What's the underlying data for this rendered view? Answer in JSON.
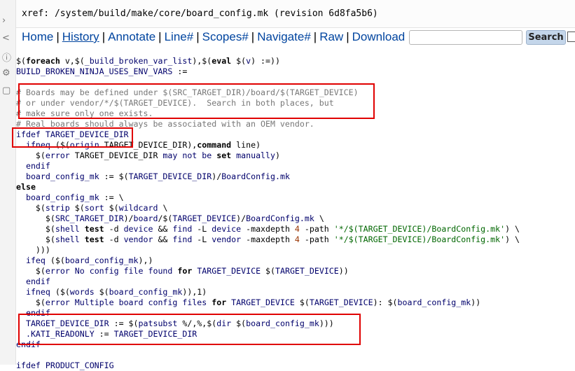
{
  "xref": {
    "text": "xref: /system/build/make/core/board_config.mk (revision 6d8fa5b6)"
  },
  "menu": [
    {
      "label": "Home"
    },
    {
      "label": "History"
    },
    {
      "label": "Annotate"
    },
    {
      "label": "Line#"
    },
    {
      "label": "Scopes#"
    },
    {
      "label": "Navigate#"
    },
    {
      "label": "Raw"
    },
    {
      "label": "Download"
    }
  ],
  "search": {
    "button": "Search",
    "value": ""
  },
  "left_icons": [
    "arrow-icon",
    "share-icon",
    "info-icon",
    "settings-icon",
    "file-icon"
  ],
  "code_lines": [
    [
      [
        "f",
        "$("
      ],
      [
        "k",
        "foreach"
      ],
      [
        "f",
        " v,$("
      ],
      [
        "v",
        "_build_broken_var_list"
      ],
      [
        "f",
        "),$("
      ],
      [
        "k",
        "eval"
      ],
      [
        "f",
        " $("
      ],
      [
        "v",
        "v"
      ],
      [
        "f",
        ") :=))"
      ]
    ],
    [
      [
        "v",
        "BUILD_BROKEN_NINJA_USES_ENV_VARS"
      ],
      [
        "f",
        " :="
      ]
    ],
    [
      [
        "f",
        ""
      ]
    ],
    [
      [
        "c",
        "# Boards may be defined under $(SRC_TARGET_DIR)/board/$(TARGET_DEVICE)"
      ]
    ],
    [
      [
        "c",
        "# or under vendor/*/$(TARGET_DEVICE).  Search in both places, but"
      ]
    ],
    [
      [
        "c",
        "# make sure only one exists."
      ]
    ],
    [
      [
        "c",
        "# Real boards should always be associated with an OEM vendor."
      ]
    ],
    [
      [
        "v",
        "ifdef TARGET_DEVICE_DIR"
      ]
    ],
    [
      [
        "f",
        "  "
      ],
      [
        "v",
        "ifneq"
      ],
      [
        "f",
        " ($("
      ],
      [
        "v",
        "origin"
      ],
      [
        "f",
        " TARGET_DEVICE_DIR),"
      ],
      [
        "k",
        "command"
      ],
      [
        "f",
        " line)"
      ]
    ],
    [
      [
        "f",
        "    $("
      ],
      [
        "v",
        "error"
      ],
      [
        "f",
        " TARGET_DEVICE_DIR "
      ],
      [
        "v",
        "may not be"
      ],
      [
        "f",
        " "
      ],
      [
        "k",
        "set"
      ],
      [
        "f",
        " "
      ],
      [
        "v",
        "manually"
      ],
      [
        "f",
        ")"
      ]
    ],
    [
      [
        "f",
        "  "
      ],
      [
        "v",
        "endif"
      ]
    ],
    [
      [
        "f",
        "  "
      ],
      [
        "v",
        "board_config_mk"
      ],
      [
        "f",
        " := $("
      ],
      [
        "v",
        "TARGET_DEVICE_DIR"
      ],
      [
        "f",
        ")/"
      ],
      [
        "v",
        "BoardConfig.mk"
      ]
    ],
    [
      [
        "k",
        "else"
      ]
    ],
    [
      [
        "f",
        "  "
      ],
      [
        "v",
        "board_config_mk"
      ],
      [
        "f",
        " := \\"
      ]
    ],
    [
      [
        "f",
        "    $("
      ],
      [
        "v",
        "strip"
      ],
      [
        "f",
        " $("
      ],
      [
        "v",
        "sort"
      ],
      [
        "f",
        " $("
      ],
      [
        "v",
        "wildcard"
      ],
      [
        "f",
        " \\"
      ]
    ],
    [
      [
        "f",
        "      $("
      ],
      [
        "v",
        "SRC_TARGET_DIR"
      ],
      [
        "f",
        ")/"
      ],
      [
        "v",
        "board"
      ],
      [
        "f",
        "/$("
      ],
      [
        "v",
        "TARGET_DEVICE"
      ],
      [
        "f",
        ")/"
      ],
      [
        "v",
        "BoardConfig.mk"
      ],
      [
        "f",
        " \\"
      ]
    ],
    [
      [
        "f",
        "      $("
      ],
      [
        "v",
        "shell"
      ],
      [
        "f",
        " "
      ],
      [
        "k",
        "test"
      ],
      [
        "f",
        " -d "
      ],
      [
        "v",
        "device"
      ],
      [
        "f",
        " && "
      ],
      [
        "v",
        "find"
      ],
      [
        "f",
        " -L "
      ],
      [
        "v",
        "device"
      ],
      [
        "f",
        " -maxdepth "
      ],
      [
        "n",
        "4"
      ],
      [
        "f",
        " -path "
      ],
      [
        "s",
        "'*/$(TARGET_DEVICE)/BoardConfig.mk'"
      ],
      [
        "f",
        ") \\"
      ]
    ],
    [
      [
        "f",
        "      $("
      ],
      [
        "v",
        "shell"
      ],
      [
        "f",
        " "
      ],
      [
        "k",
        "test"
      ],
      [
        "f",
        " -d "
      ],
      [
        "v",
        "vendor"
      ],
      [
        "f",
        " && "
      ],
      [
        "v",
        "find"
      ],
      [
        "f",
        " -L "
      ],
      [
        "v",
        "vendor"
      ],
      [
        "f",
        " -maxdepth "
      ],
      [
        "n",
        "4"
      ],
      [
        "f",
        " -path "
      ],
      [
        "s",
        "'*/$(TARGET_DEVICE)/BoardConfig.mk'"
      ],
      [
        "f",
        ") \\"
      ]
    ],
    [
      [
        "f",
        "    )))"
      ]
    ],
    [
      [
        "f",
        "  "
      ],
      [
        "v",
        "ifeq"
      ],
      [
        "f",
        " ($("
      ],
      [
        "v",
        "board_config_mk"
      ],
      [
        "f",
        "),)"
      ]
    ],
    [
      [
        "f",
        "    $("
      ],
      [
        "v",
        "error"
      ],
      [
        "f",
        " "
      ],
      [
        "v",
        "No config file found"
      ],
      [
        "f",
        " "
      ],
      [
        "k",
        "for"
      ],
      [
        "f",
        " "
      ],
      [
        "v",
        "TARGET_DEVICE"
      ],
      [
        "f",
        " $("
      ],
      [
        "v",
        "TARGET_DEVICE"
      ],
      [
        "f",
        "))"
      ]
    ],
    [
      [
        "f",
        "  "
      ],
      [
        "v",
        "endif"
      ]
    ],
    [
      [
        "f",
        "  "
      ],
      [
        "v",
        "ifneq"
      ],
      [
        "f",
        " ($("
      ],
      [
        "v",
        "words"
      ],
      [
        "f",
        " $("
      ],
      [
        "v",
        "board_config_mk"
      ],
      [
        "f",
        ")),1)"
      ]
    ],
    [
      [
        "f",
        "    $("
      ],
      [
        "v",
        "error"
      ],
      [
        "f",
        " "
      ],
      [
        "v",
        "Multiple board config files"
      ],
      [
        "f",
        " "
      ],
      [
        "k",
        "for"
      ],
      [
        "f",
        " "
      ],
      [
        "v",
        "TARGET_DEVICE"
      ],
      [
        "f",
        " $("
      ],
      [
        "v",
        "TARGET_DEVICE"
      ],
      [
        "f",
        "): $("
      ],
      [
        "v",
        "board_config_mk"
      ],
      [
        "f",
        "))"
      ]
    ],
    [
      [
        "f",
        "  "
      ],
      [
        "v",
        "endif"
      ]
    ],
    [
      [
        "f",
        "  "
      ],
      [
        "v",
        "TARGET_DEVICE_DIR"
      ],
      [
        "f",
        " := $("
      ],
      [
        "v",
        "patsubst"
      ],
      [
        "f",
        " %/,%,$("
      ],
      [
        "v",
        "dir"
      ],
      [
        "f",
        " $("
      ],
      [
        "v",
        "board_config_mk"
      ],
      [
        "f",
        ")))"
      ]
    ],
    [
      [
        "f",
        "  "
      ],
      [
        "v",
        ".KATI_READONLY"
      ],
      [
        "f",
        " := "
      ],
      [
        "v",
        "TARGET_DEVICE_DIR"
      ]
    ],
    [
      [
        "v",
        "endif"
      ]
    ],
    [
      [
        "f",
        ""
      ]
    ],
    [
      [
        "v",
        "ifdef PRODUCT_CONFIG"
      ]
    ]
  ]
}
